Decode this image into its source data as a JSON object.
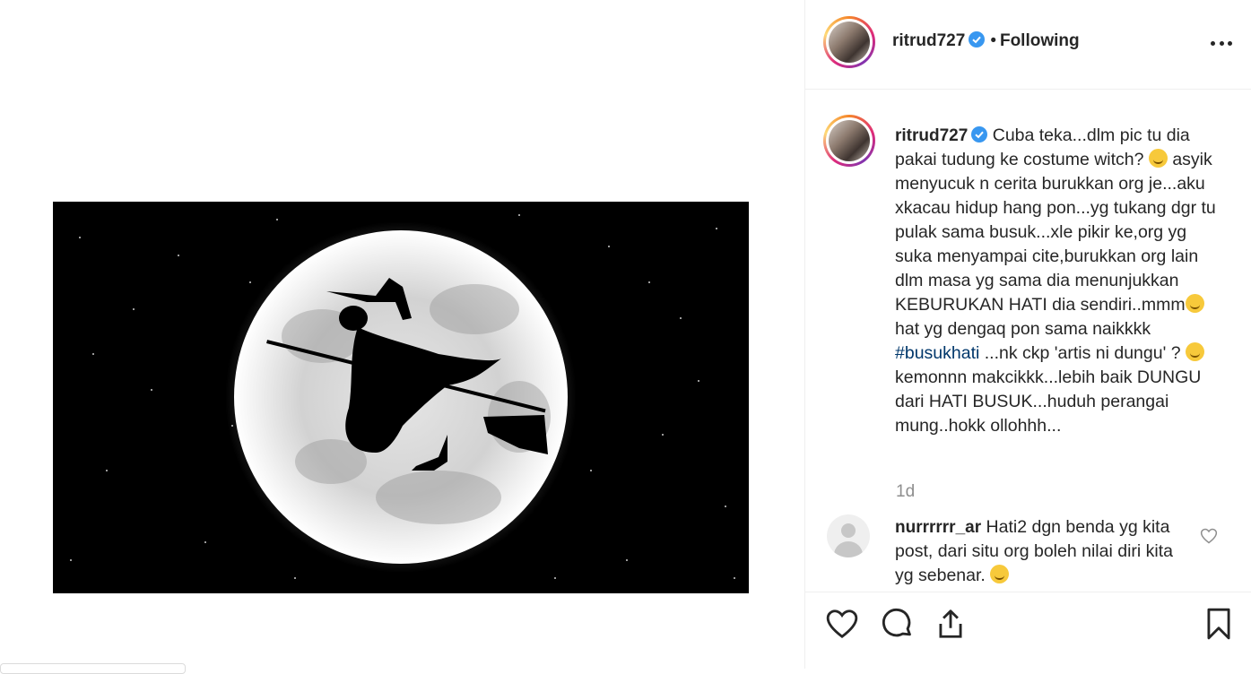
{
  "post": {
    "image_alt": "witch on a broom silhouette against a full moon"
  },
  "header": {
    "username": "ritrud727",
    "separator": "•",
    "follow_status": "Following",
    "more_icon": "more-horizontal-icon"
  },
  "caption": {
    "username": "ritrud727",
    "text_part1": "Cuba teka...dlm pic tu dia pakai tudung ke costume witch? ",
    "text_part2": " asyik menyucuk n cerita burukkan org je...aku xkacau hidup hang pon...yg tukang dgr tu pulak sama busuk...xle pikir ke,org yg suka menyampai cite,burukkan org lain dlm masa yg sama dia menunjukkan KEBURUKAN HATI dia sendiri..mmm",
    "text_part3": " hat yg dengaq pon sama naikkkk ",
    "hashtag": "#busukhati",
    "text_part4": " ...nk ckp 'artis ni dungu' ? ",
    "text_part5": " kemonnn makcikkk...lebih baik DUNGU dari HATI BUSUK...huduh perangai mung..hokk ollohhh...",
    "time_ago": "1d"
  },
  "comment": {
    "username": "nurrrrrr_ar",
    "text": "Hati2 dgn benda yg kita post, dari situ org boleh nilai diri kita yg sebenar. "
  },
  "actions": {
    "like_icon": "heart-icon",
    "comment_icon": "comment-icon",
    "share_icon": "share-icon",
    "save_icon": "bookmark-icon"
  },
  "colors": {
    "verified": "#3897f0",
    "hashtag": "#00376b",
    "muted": "#8e8e8e",
    "text": "#262626"
  }
}
